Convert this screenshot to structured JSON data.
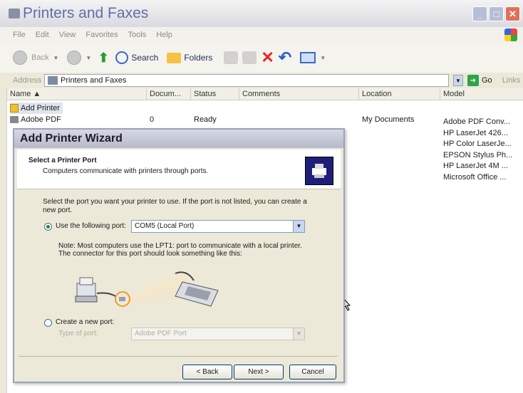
{
  "explorer": {
    "title": "Printers and Faxes",
    "menu": [
      "File",
      "Edit",
      "View",
      "Favorites",
      "Tools",
      "Help"
    ],
    "toolbar": {
      "back_label": "Back",
      "search_label": "Search",
      "folders_label": "Folders"
    },
    "address": {
      "label": "Address",
      "value": "Printers and Faxes",
      "go_label": "Go",
      "links_label": "Links"
    },
    "columns": [
      "Name",
      "Docum...",
      "Status",
      "Comments",
      "Location",
      "Model"
    ],
    "rows": [
      {
        "name": "Add Printer",
        "docs": "",
        "status": "",
        "location": ""
      },
      {
        "name": "Adobe PDF",
        "docs": "0",
        "status": "Ready",
        "location": "My Documents"
      }
    ],
    "models": [
      "Adobe PDF Conv...",
      "HP LaserJet 426...",
      "HP Color LaserJe...",
      "EPSON Stylus Ph...",
      "HP LaserJet 4M ...",
      "Microsoft Office ..."
    ]
  },
  "dialog": {
    "title": "Add Printer Wizard",
    "header_title": "Select a Printer Port",
    "header_subtitle": "Computers communicate with printers through ports.",
    "instruction": "Select the port you want your printer to use.  If the port is not listed, you can create a new port.",
    "use_port_label": "Use the following port:",
    "use_port_value": "COM5 (Local Port)",
    "note": "Note: Most computers use the LPT1: port to communicate with a local printer. The connector for this port should look something like this:",
    "create_port_label": "Create a new port:",
    "type_of_port_label": "Type of port:",
    "type_of_port_value": "Adobe PDF Port",
    "buttons": {
      "back": "< Back",
      "next": "Next >",
      "cancel": "Cancel"
    }
  },
  "colors": {
    "accent": "#1f1f7a",
    "highlight_ring": "#f39a2a"
  }
}
